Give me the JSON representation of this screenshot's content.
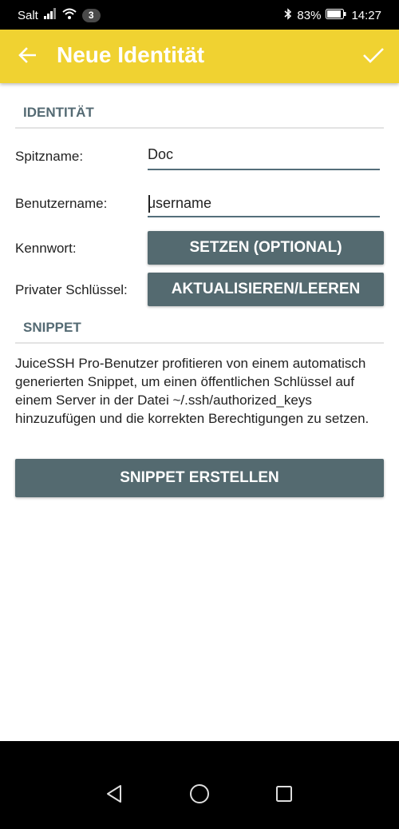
{
  "status_bar": {
    "carrier": "Salt",
    "notification_count": "3",
    "battery_percent": "83%",
    "time": "14:27"
  },
  "app_bar": {
    "title": "Neue Identität",
    "icons": {
      "back": "arrow-back-icon",
      "confirm": "check-icon"
    },
    "color": "#f0d231"
  },
  "identity_section": {
    "header": "IDENTITÄT",
    "nickname_label": "Spitzname:",
    "nickname_value": "Doc",
    "username_label": "Benutzername:",
    "username_value": "username",
    "password_label": "Kennwort:",
    "password_button": "SETZEN (OPTIONAL)",
    "private_key_label": "Privater Schlüssel:",
    "private_key_button": "AKTUALISIEREN/LEEREN"
  },
  "snippet_section": {
    "header": "SNIPPET",
    "description": "JuiceSSH Pro-Benutzer profitieren von einem automatisch generierten Snippet, um einen öffentlichen Schlüssel auf einem Server in der Datei ~/.ssh/authorized_keys hinzuzufügen und die korrekten Berechtigungen zu setzen.",
    "create_button": "SNIPPET ERSTELLEN"
  },
  "nav_bar": {
    "icons": [
      "back-triangle-icon",
      "home-circle-icon",
      "recents-square-icon"
    ]
  },
  "colors": {
    "accent": "#f0d231",
    "button": "#546a70",
    "section_header_text": "#546a73"
  }
}
